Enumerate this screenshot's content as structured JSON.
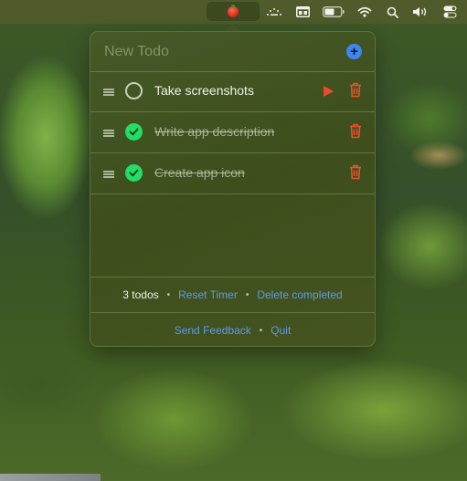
{
  "menubar": {
    "icons": [
      {
        "name": "tomato-timer-icon",
        "active": true
      },
      {
        "name": "brightness-dots-icon"
      },
      {
        "name": "window-layout-icon"
      },
      {
        "name": "battery-icon"
      },
      {
        "name": "wifi-icon"
      },
      {
        "name": "spotlight-search-icon"
      },
      {
        "name": "volume-icon"
      },
      {
        "name": "control-center-icon"
      }
    ]
  },
  "popover": {
    "new_todo": {
      "placeholder": "New Todo",
      "value": "",
      "add_icon": "plus-circle-icon"
    },
    "todos": [
      {
        "text": "Take screenshots",
        "completed": false,
        "has_play": true
      },
      {
        "text": "Write app description",
        "completed": true,
        "has_play": false
      },
      {
        "text": "Create app icon",
        "completed": true,
        "has_play": false
      }
    ],
    "footer": {
      "count_label": "3 todos",
      "separator": "•",
      "reset_timer": "Reset Timer",
      "delete_completed": "Delete completed",
      "send_feedback": "Send Feedback",
      "quit": "Quit"
    }
  },
  "colors": {
    "accent_blue": "#3f86f0",
    "link_blue": "#5c9ae6",
    "done_green": "#22dd66",
    "danger_red": "#f04a2e"
  }
}
